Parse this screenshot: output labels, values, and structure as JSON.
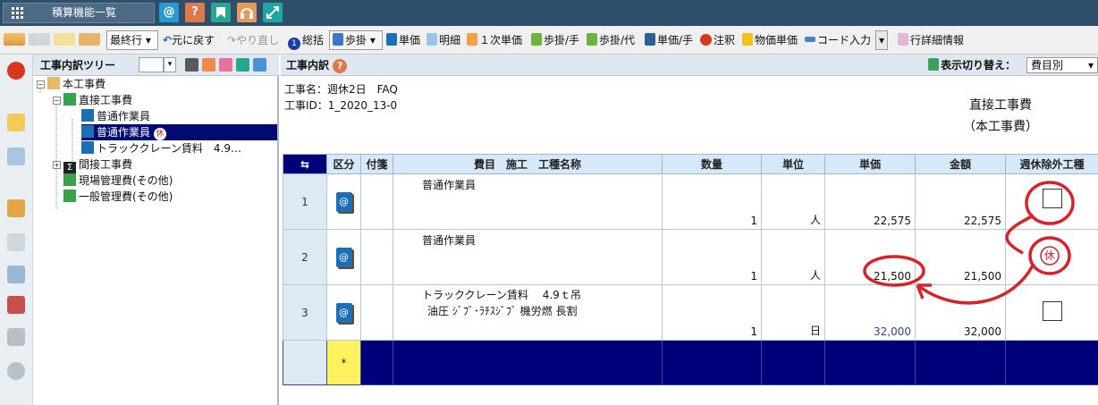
{
  "app": {
    "menu_label": "積算機能一覧"
  },
  "top_buttons": [
    {
      "icon": "at-icon",
      "label": "@",
      "color": "#2b98d6"
    },
    {
      "icon": "help-icon",
      "label": "?",
      "color": "#e0784a"
    },
    {
      "icon": "bookmark-icon",
      "label": "",
      "color": "#26a88e"
    },
    {
      "icon": "headset-icon",
      "label": "",
      "color": "#e99a5b"
    },
    {
      "icon": "expand-icon",
      "label": "",
      "color": "#1ea6a0"
    }
  ],
  "toolbar": {
    "scope_select": "最終行",
    "undo": "元に戻す",
    "redo": "やり直し",
    "summary": "総括",
    "rate_select": "歩掛",
    "unit_price": "単価",
    "detail": "明細",
    "primary_unit_price": "１次単価",
    "rate_manual": "歩掛/手",
    "rate_alt": "歩掛/代",
    "unit_price_manual": "単価/手",
    "note": "注釈",
    "material_price": "物価単価",
    "code_input": "コード入力",
    "row_detail": "行詳細情報"
  },
  "tree": {
    "title": "工事内訳ツリー",
    "nodes": [
      {
        "label": "本工事費"
      },
      {
        "label": "直接工事費"
      },
      {
        "label": "普通作業員"
      },
      {
        "label": "普通作業員",
        "badge": "休"
      },
      {
        "label": "トラッククレーン賃料　4.9…"
      },
      {
        "label": "間接工事費"
      },
      {
        "label": "現場管理費(その他)"
      },
      {
        "label": "一般管理費(その他)"
      }
    ]
  },
  "main": {
    "title": "工事内訳",
    "view_switch_label": "表示切り替え：",
    "view_switch_value": "費目別",
    "project_name": "工事名：週休2日　FAQ",
    "project_id": "工事ID：1_2020_13-0",
    "section_line1": "直接工事費",
    "section_line2": "（本工事費）"
  },
  "grid": {
    "headers": {
      "kubun": "区分",
      "fusen": "付箋",
      "name": "費目　施工　工種名称",
      "qty": "数量",
      "unit": "単位",
      "price": "単価",
      "amount": "金額",
      "exclude": "週休除外工種"
    },
    "rows": [
      {
        "no": "1",
        "name1": "普通作業員",
        "name2": "",
        "qty": "1",
        "unit": "人",
        "price": "22,575",
        "amount": "22,575",
        "price_color": "#111111",
        "checkbox": true
      },
      {
        "no": "2",
        "name1": "普通作業員",
        "name2": "",
        "qty": "1",
        "unit": "人",
        "price": "21,500",
        "amount": "21,500",
        "price_color": "#111111",
        "checkbox": false
      },
      {
        "no": "3",
        "name1": "トラッククレーン賃料　 4.9ｔ吊",
        "name2": "油圧 ｼﾞﾌﾞ･ﾗﾁｽｼﾞﾌﾞ 機労燃 長割",
        "qty": "1",
        "unit": "日",
        "price": "32,000",
        "amount": "32,000",
        "price_color": "#2a3fa8",
        "checkbox": true
      }
    ],
    "new_row_marker": "*"
  },
  "annotation": {
    "label": "休",
    "color": "#d8222a"
  }
}
